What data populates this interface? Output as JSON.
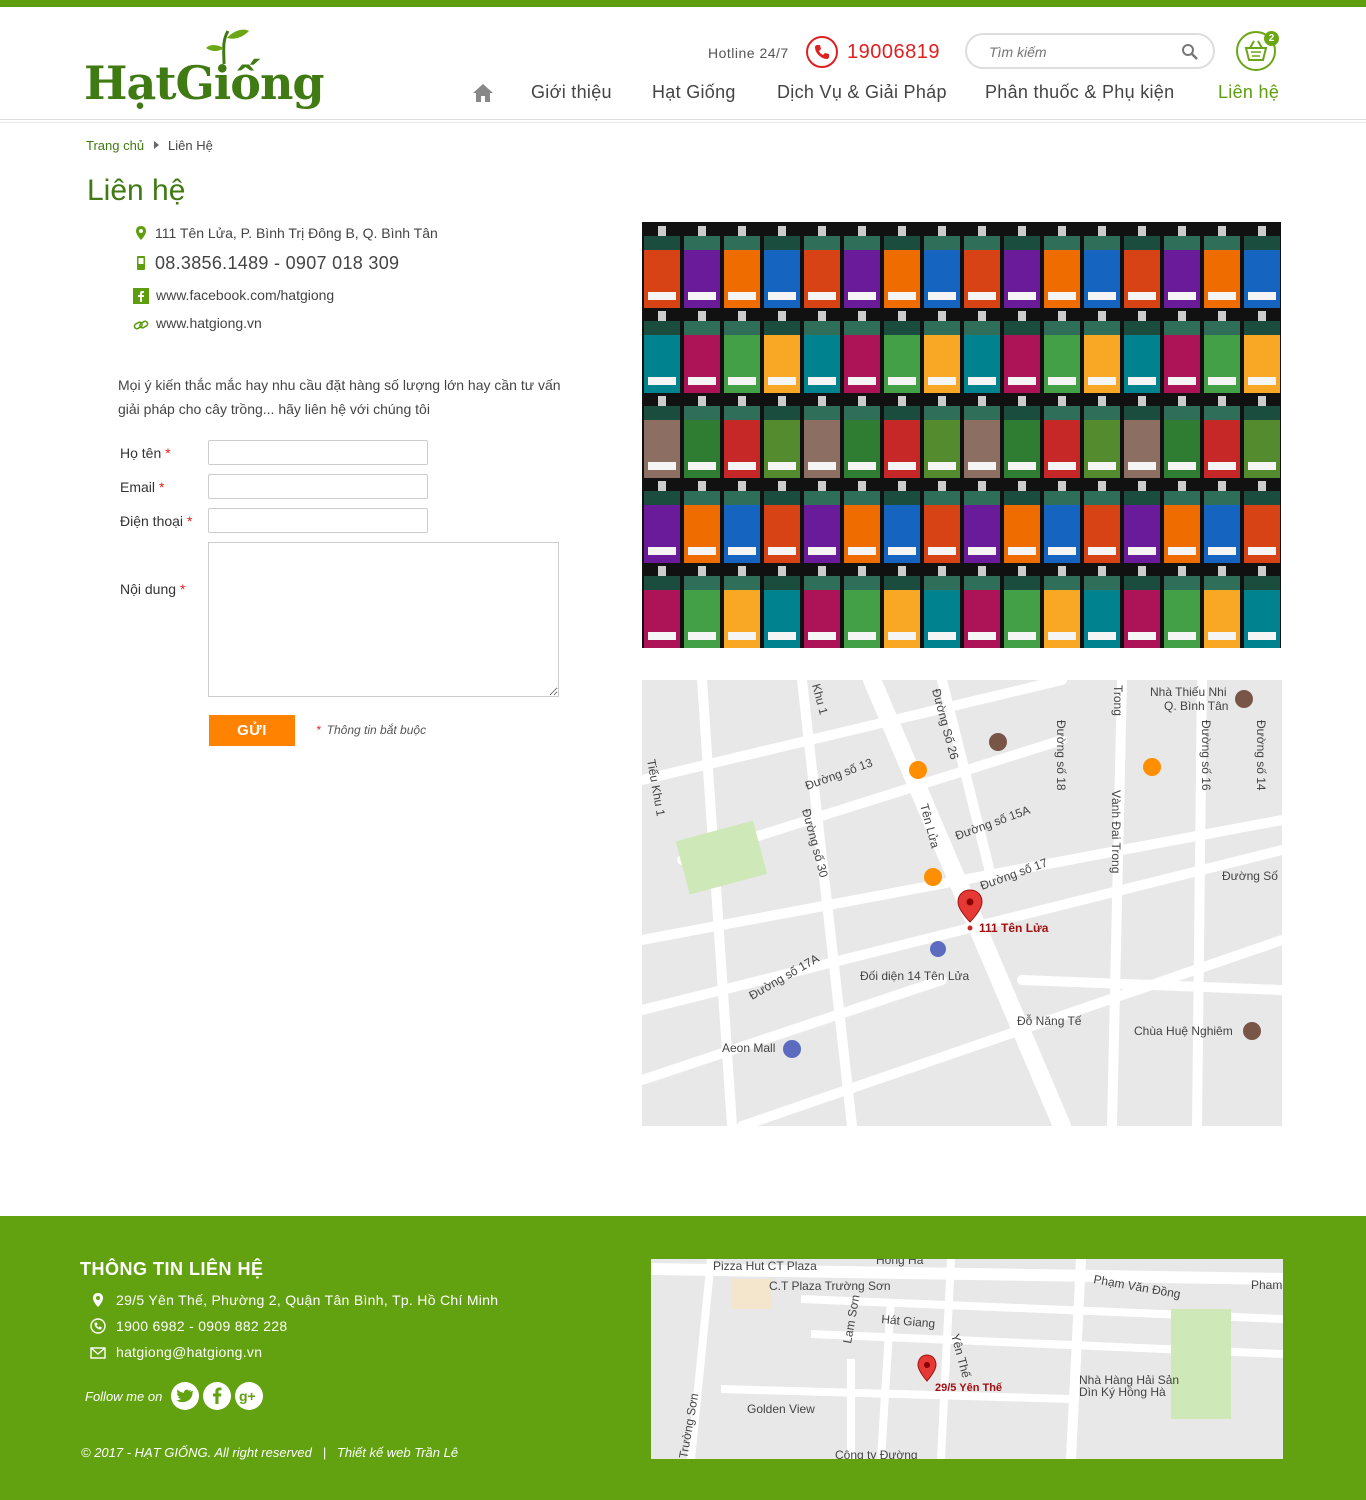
{
  "header": {
    "logo": "HạtGiống",
    "hotline_label": "Hotline 24/7",
    "hotline_number": "19006819",
    "search_placeholder": "Tìm kiếm",
    "cart_count": "2",
    "nav": [
      "Giới thiệu",
      "Hạt Giống",
      "Dịch Vụ & Giải Pháp",
      "Phân thuốc & Phụ kiện",
      "Liên hệ"
    ]
  },
  "breadcrumb": {
    "home": "Trang chủ",
    "current": "Liên Hệ"
  },
  "page_title": "Liên hệ",
  "contact": {
    "address": "111 Tên Lửa, P. Bình Trị Đông B, Q. Bình Tân",
    "phone": "08.3856.1489 - 0907 018 309",
    "facebook": "www.facebook.com/hatgiong",
    "website": "www.hatgiong.vn"
  },
  "intro": "Mọi ý kiến thắc mắc hay nhu cầu đặt hàng số lượng lớn hay cần tư vấn giải pháp cho cây trồng... hãy liên hệ với chúng tôi",
  "form": {
    "name_label": "Họ tên",
    "email_label": "Email",
    "phone_label": "Điện thoại",
    "content_label": "Nội dung",
    "required_mark": "*",
    "send_label": "GỬI",
    "required_note": "Thông tin bắt buộc"
  },
  "map": {
    "labels": [
      "Nhà Thiếu Nhi",
      "Q. Bình Tân",
      "Đường số 13",
      "Đường Số 26",
      "Đường số 18",
      "Vành Đai Trong",
      "Đường số 16",
      "Đường số 14",
      "Đường số 15A",
      "Đường số 17",
      "Đường Số",
      "Đường số 30",
      "Tên Lửa",
      "Đối diện 14 Tên Lửa",
      "Đỗ Năng Tế",
      "Chùa Huệ Nghiêm",
      "Đường số 17A",
      "Aeon Mall",
      "Khu 1",
      "Tiểu Khu 1",
      "Trong"
    ],
    "pin_label": "111 Tên Lửa"
  },
  "footer": {
    "title": "THÔNG TIN LIÊN HỆ",
    "address": "29/5 Yên Thế, Phường 2, Quận Tân Bình, Tp. Hồ Chí Minh",
    "phone": "1900 6982 - 0909 882 228",
    "email": "hatgiong@hatgiong.vn",
    "follow": "Follow me on",
    "copyright": "© 2017 - HẠT GIỐNG. All right reserved   |   Thiết kế web Trần Lê",
    "map_labels": [
      "Pizza Hut CT Plaza",
      "C.T Plaza Trường Sơn",
      "Hồng Hà",
      "Phạm Văn Đồng",
      "Hát Giang",
      "Yên Thế",
      "Lam Sơn",
      "Golden View",
      "Nhà Hàng Hải Sản",
      "Dìn Ký Hồng Hà",
      "Công ty Đường",
      "Trường Sơn",
      "Pham"
    ],
    "map_pin": "29/5 Yên Thế"
  },
  "colors": {
    "brand_green": "#5e9e0e",
    "hotline_red": "#e02020",
    "button_orange": "#ff8200"
  }
}
